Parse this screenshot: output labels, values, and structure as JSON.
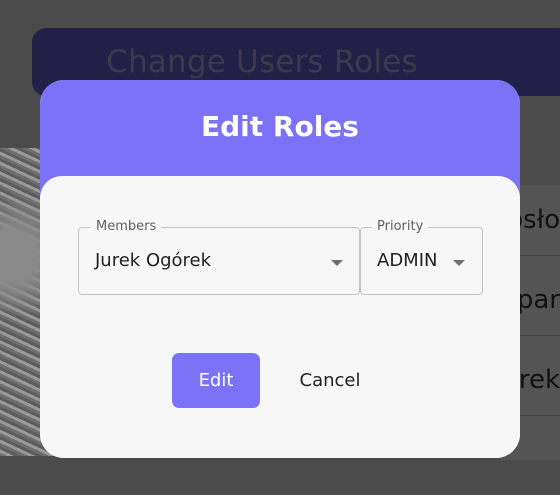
{
  "background": {
    "banner_title": "Change Users Roles",
    "rows": [
      "osło",
      "par",
      "rek"
    ]
  },
  "modal": {
    "title": "Edit Roles",
    "members": {
      "legend": "Members",
      "value": "Jurek Ogórek"
    },
    "priority": {
      "legend": "Priority",
      "value": "ADMIN"
    },
    "edit_label": "Edit",
    "cancel_label": "Cancel"
  },
  "colors": {
    "accent": "#7b72f8",
    "overlay": "#4b4b4b",
    "modal_bg": "#f7f7f7"
  }
}
